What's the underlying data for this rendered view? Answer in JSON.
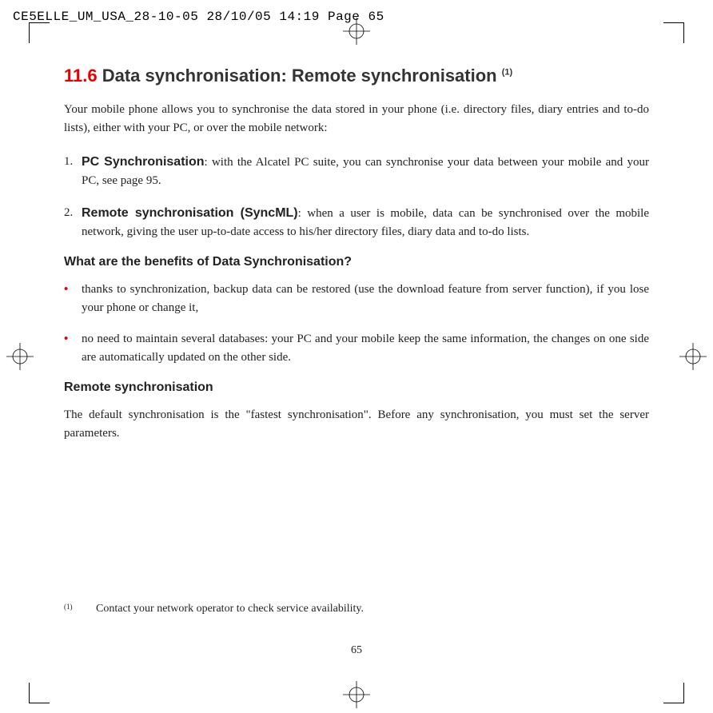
{
  "header": "CE5ELLE_UM_USA_28-10-05  28/10/05  14:19  Page 65",
  "section_num": "11.6",
  "section_title": "Data synchronisation: Remote synchronisation",
  "section_sup": "(1)",
  "intro": "Your mobile phone allows you to synchronise the data stored in your phone (i.e. directory files, diary entries and to-do lists), either with your PC, or over the mobile network:",
  "items": [
    {
      "num": "1.",
      "lead": "PC Synchronisation",
      "rest": ": with the Alcatel PC suite, you can synchronise your data between your mobile and your PC, see page 95."
    },
    {
      "num": "2.",
      "lead": "Remote synchronisation (SyncML)",
      "rest": ": when a user is mobile, data can be synchronised over the mobile network, giving the user up-to-date access to his/her directory files, diary data and to-do lists."
    }
  ],
  "subhead1": "What are the benefits of Data Synchronisation?",
  "bullets": [
    "thanks to synchronization, backup data can be restored (use the download feature from server function), if you lose your phone or change it,",
    "no need to maintain several databases: your PC and your mobile keep the same information, the changes on one side are automatically updated on the other side."
  ],
  "subhead2": "Remote synchronisation",
  "para": "The default synchronisation is the \"fastest synchronisation\". Before any synchronisation, you must set the server parameters.",
  "footnote_mark": "(1)",
  "footnote": "Contact your network operator to check service availability.",
  "page_num": "65"
}
